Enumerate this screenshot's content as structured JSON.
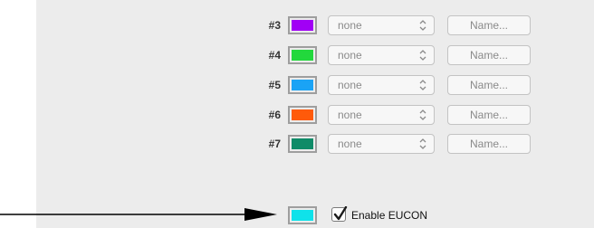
{
  "rows": [
    {
      "label": "#3",
      "color": "#a100f5",
      "select_value": "none",
      "button_label": "Name..."
    },
    {
      "label": "#4",
      "color": "#22d83c",
      "select_value": "none",
      "button_label": "Name..."
    },
    {
      "label": "#5",
      "color": "#1aa3f5",
      "select_value": "none",
      "button_label": "Name..."
    },
    {
      "label": "#6",
      "color": "#ff5a0a",
      "select_value": "none",
      "button_label": "Name..."
    },
    {
      "label": "#7",
      "color": "#0f8b68",
      "select_value": "none",
      "button_label": "Name..."
    }
  ],
  "eucon": {
    "color": "#0fe2ea",
    "checkbox_label": "Enable EUCON",
    "checked": true
  },
  "icons": {
    "select_arrows": "updown-arrows-icon",
    "pointer": "arrow-right-icon",
    "checkmark": "checkmark-icon"
  }
}
